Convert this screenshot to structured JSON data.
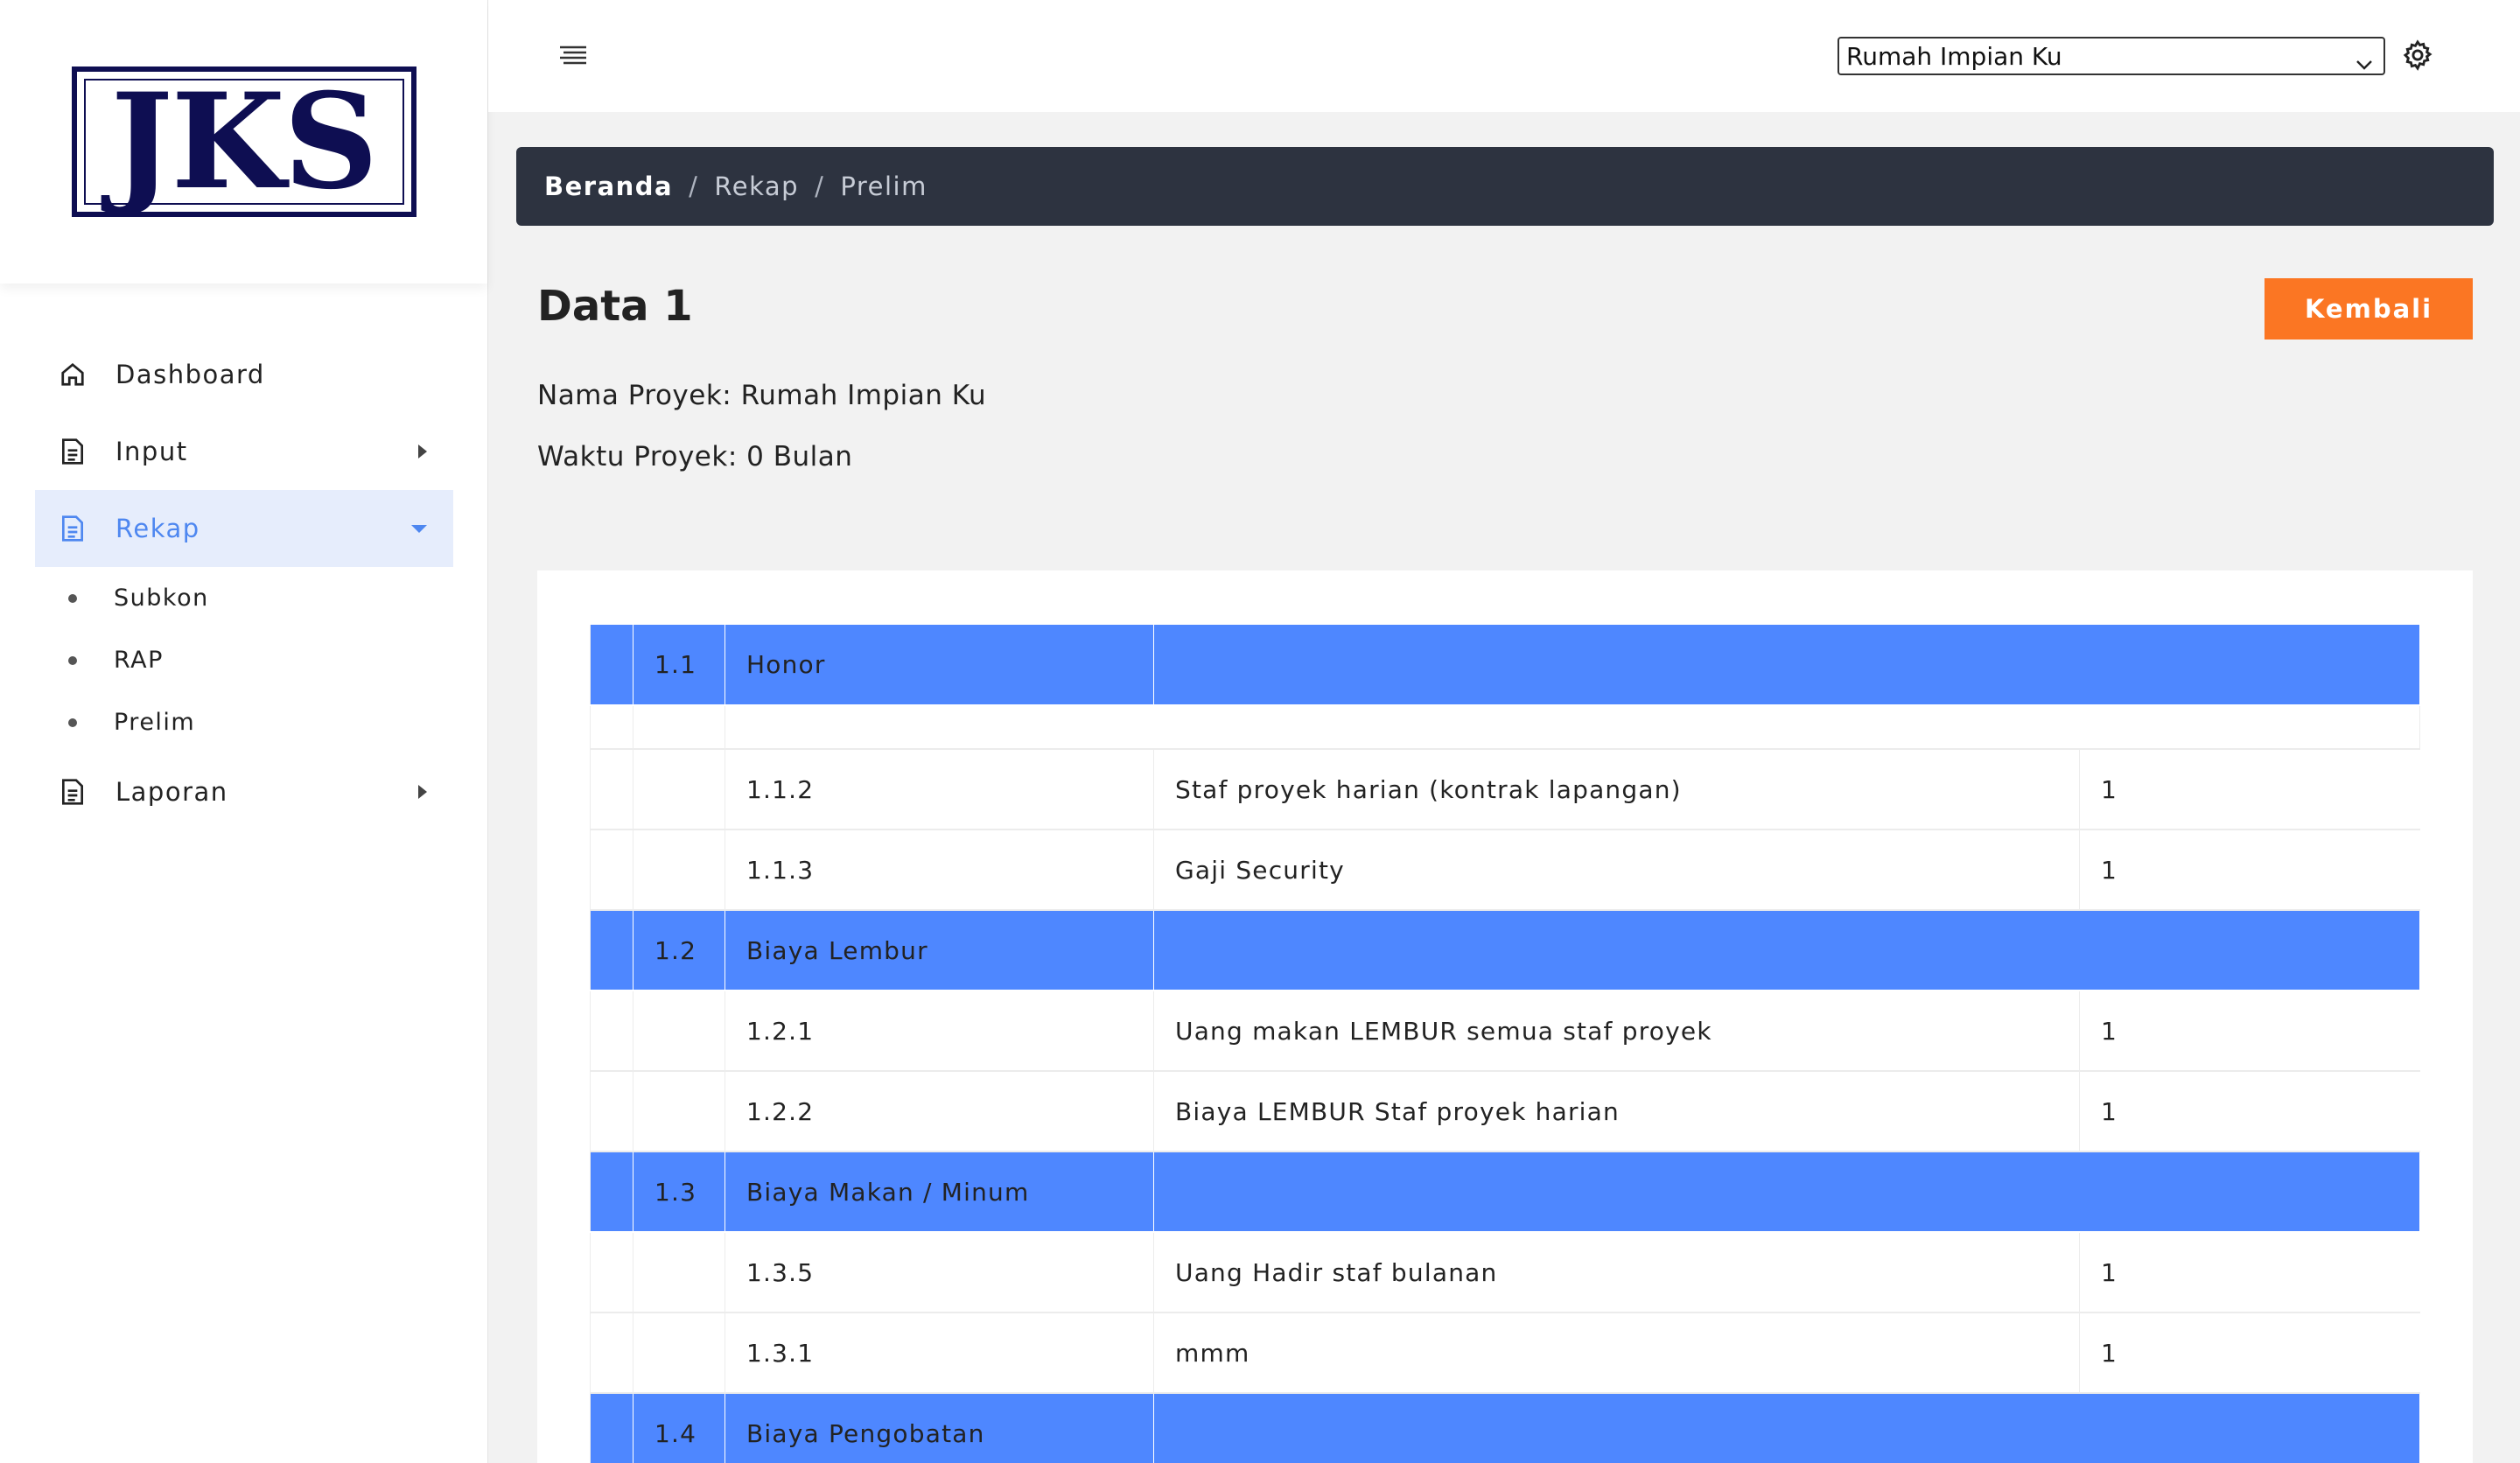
{
  "logo": {
    "text": "JKS"
  },
  "sidebar": {
    "items": [
      {
        "label": "Dashboard",
        "icon": "home-icon"
      },
      {
        "label": "Input",
        "icon": "document-icon"
      },
      {
        "label": "Rekap",
        "icon": "document-icon",
        "active": true
      },
      {
        "label": "Laporan",
        "icon": "document-icon"
      }
    ],
    "subitems": [
      "Subkon",
      "RAP",
      "Prelim"
    ]
  },
  "topbar": {
    "menu_icon": "hamburger-menu-icon",
    "project_select": "Rumah Impian Ku",
    "settings_icon": "gear-icon"
  },
  "breadcrumb": [
    "Beranda",
    "Rekap",
    "Prelim"
  ],
  "page": {
    "title": "Data 1",
    "back_label": "Kembali",
    "project_name": "Nama Proyek: Rumah Impian Ku",
    "project_time": "Waktu Proyek: 0 Bulan"
  },
  "table": {
    "rows": [
      {
        "type": "group",
        "code": "1.1",
        "name": "Honor"
      },
      {
        "type": "blank"
      },
      {
        "type": "item",
        "code": "1.1.2",
        "desc": "Staf proyek harian (kontrak lapangan)",
        "value": "1"
      },
      {
        "type": "item",
        "code": "1.1.3",
        "desc": "Gaji Security",
        "value": "1"
      },
      {
        "type": "group",
        "code": "1.2",
        "name": "Biaya Lembur"
      },
      {
        "type": "item",
        "code": "1.2.1",
        "desc": "Uang makan LEMBUR semua staf proyek",
        "value": "1"
      },
      {
        "type": "item",
        "code": "1.2.2",
        "desc": "Biaya LEMBUR Staf proyek harian",
        "value": "1"
      },
      {
        "type": "group",
        "code": "1.3",
        "name": "Biaya Makan / Minum"
      },
      {
        "type": "item",
        "code": "1.3.5",
        "desc": "Uang Hadir staf bulanan",
        "value": "1"
      },
      {
        "type": "item",
        "code": "1.3.1",
        "desc": "mmm",
        "value": "1"
      },
      {
        "type": "group",
        "code": "1.4",
        "name": "Biaya Pengobatan"
      }
    ]
  },
  "colors": {
    "accent": "#4e87ff",
    "button": "#fb7623",
    "breadcrumb_bg": "#2d3340"
  }
}
